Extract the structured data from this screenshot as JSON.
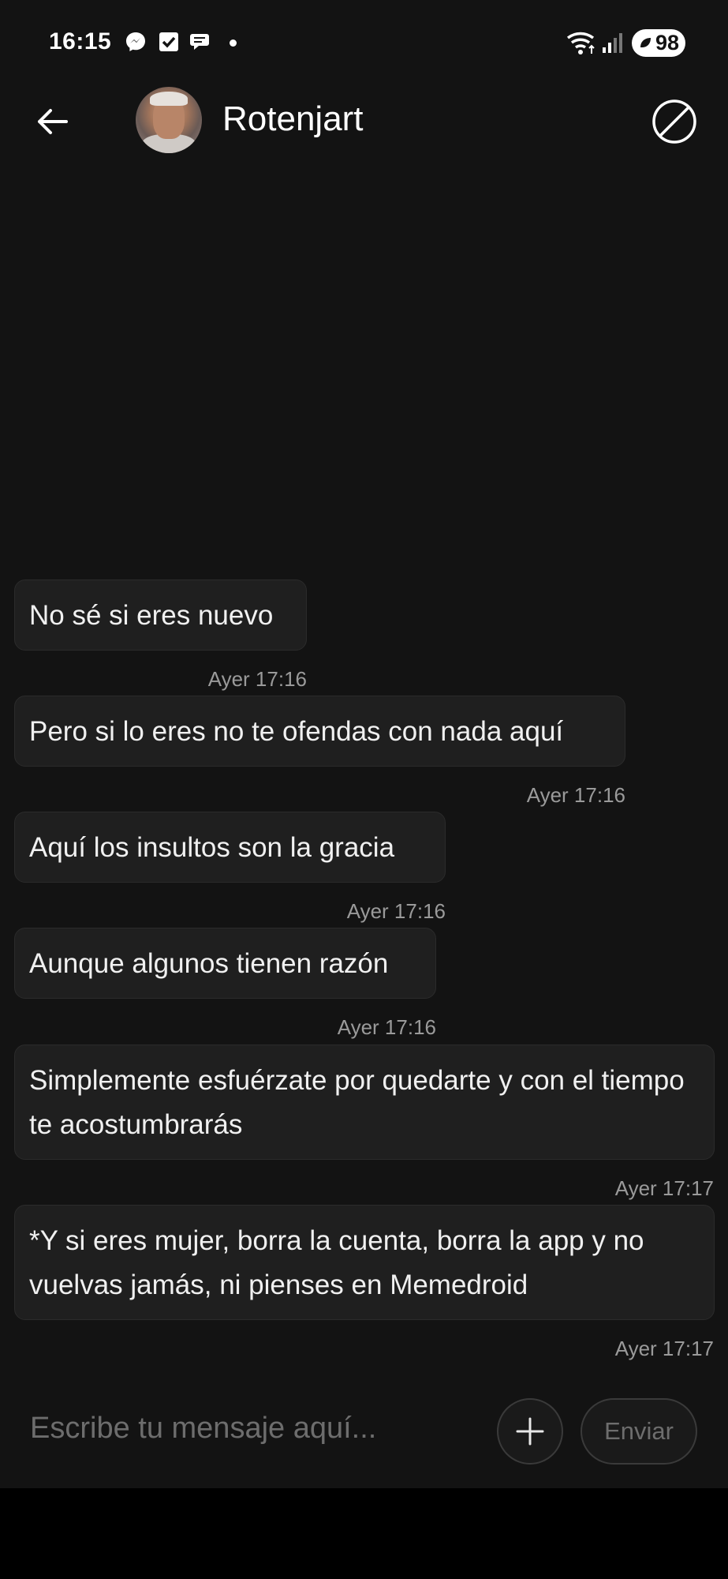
{
  "status_bar": {
    "time": "16:15",
    "icons": [
      "messenger-icon",
      "checkbox-icon",
      "chat-bubble-icon",
      "notification-dot-icon",
      "wifi-icon",
      "cellular-signal-icon"
    ],
    "battery": "98"
  },
  "header": {
    "contact_name": "Rotenjart",
    "back_icon": "arrow-left-icon",
    "block_icon": "block-icon"
  },
  "messages": [
    {
      "text": "No sé si eres nuevo",
      "time": "Ayer 17:16"
    },
    {
      "text": "Pero si lo eres no te ofendas con nada aquí",
      "time": "Ayer 17:16"
    },
    {
      "text": "Aquí los insultos son la gracia",
      "time": "Ayer 17:16"
    },
    {
      "text": "Aunque algunos tienen razón",
      "time": "Ayer 17:16"
    },
    {
      "text": "Simplemente esfuérzate por quedarte y con el tiempo te acostumbrarás",
      "time": "Ayer 17:17"
    },
    {
      "text": "*Y si eres mujer, borra la cuenta, borra la app y no vuelvas jamás, ni pienses en Memedroid",
      "time": "Ayer 17:17"
    }
  ],
  "composer": {
    "placeholder": "Escribe tu mensaje aquí...",
    "send_label": "Enviar",
    "plus_icon": "plus-icon"
  },
  "colors": {
    "background": "#131313",
    "bubble": "#1f1f1f",
    "timestamp": "#9a9a9a",
    "placeholder": "#6d6d6d"
  }
}
